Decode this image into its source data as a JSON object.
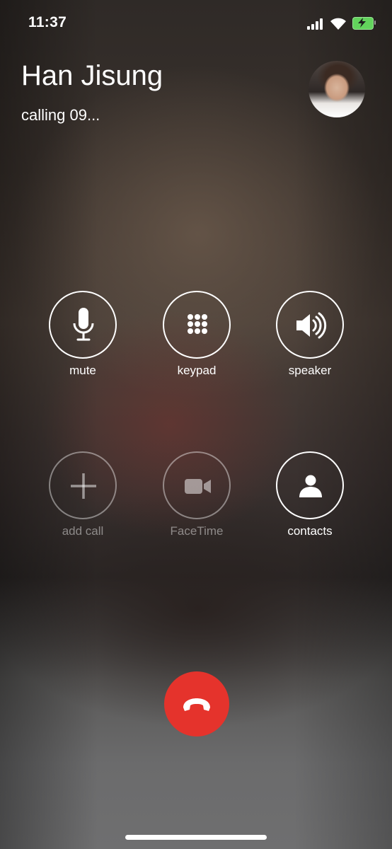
{
  "status_bar": {
    "time": "11:37",
    "battery_color": "#62d35c"
  },
  "caller": {
    "name": "Han Jisung",
    "status": "calling 09..."
  },
  "controls": {
    "mute": {
      "label": "mute",
      "icon": "microphone-icon"
    },
    "keypad": {
      "label": "keypad",
      "icon": "keypad-grid-icon"
    },
    "speaker": {
      "label": "speaker",
      "icon": "speaker-icon"
    },
    "add_call": {
      "label": "add call",
      "icon": "plus-icon"
    },
    "facetime": {
      "label": "FaceTime",
      "icon": "video-camera-icon"
    },
    "contacts": {
      "label": "contacts",
      "icon": "person-icon"
    }
  },
  "end_call": {
    "icon": "phone-hangup-icon",
    "color": "#e5332c"
  }
}
